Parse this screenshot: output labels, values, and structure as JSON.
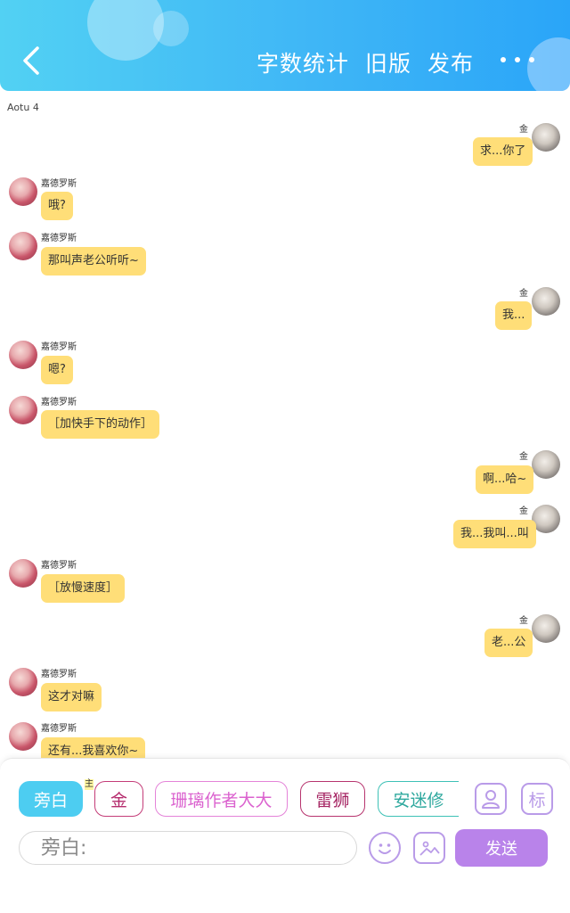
{
  "header": {
    "actions": [
      "字数统计",
      "旧版",
      "发布"
    ],
    "back_icon": "chevron-left-icon",
    "more_icon": "more-dots-icon"
  },
  "chat_title": "Aotu 4",
  "messages": [
    {
      "side": "right",
      "sender": "金",
      "text": "求...你了"
    },
    {
      "side": "left",
      "sender": "嘉德罗斯",
      "text": "哦?"
    },
    {
      "side": "left",
      "sender": "嘉德罗斯",
      "text": "那叫声老公听听~"
    },
    {
      "side": "right",
      "sender": "金",
      "text": "我..."
    },
    {
      "side": "left",
      "sender": "嘉德罗斯",
      "text": "嗯?"
    },
    {
      "side": "left",
      "sender": "嘉德罗斯",
      "text": "［加快手下的动作］"
    },
    {
      "side": "right",
      "sender": "金",
      "text": "啊...哈~"
    },
    {
      "side": "right",
      "sender": "金",
      "text": "我...我叫...叫"
    },
    {
      "side": "left",
      "sender": "嘉德罗斯",
      "text": "［放慢速度］"
    },
    {
      "side": "right",
      "sender": "金",
      "text": "老...公"
    },
    {
      "side": "left",
      "sender": "嘉德罗斯",
      "text": "这才对嘛"
    },
    {
      "side": "left",
      "sender": "嘉德罗斯",
      "text": "还有...我喜欢你~"
    }
  ],
  "composer": {
    "roles": [
      "旁白",
      "金",
      "珊璃作者大大",
      "雷狮",
      "安迷修"
    ],
    "main_mark": "主",
    "input_placeholder": "旁白:",
    "send_label": "发送",
    "biao_label": "标",
    "icons": [
      "person-card-icon",
      "tag-icon",
      "emoji-icon",
      "image-icon"
    ]
  },
  "colors": {
    "header_gradient_start": "#52d1f3",
    "header_gradient_end": "#2aa5f8",
    "bubble": "#ffde78",
    "send_button": "#b983ea",
    "narration_chip": "#4dcdf1"
  }
}
